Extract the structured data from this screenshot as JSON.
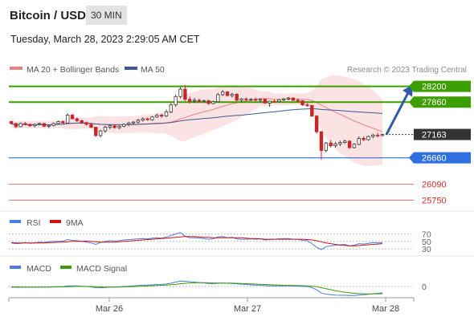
{
  "header": {
    "title": "Bitcoin / USD",
    "interval": "30 MIN",
    "datetime": "Tuesday, March 28, 2023 2:29:05 AM CET"
  },
  "legend": {
    "ma20": "MA 20 + Bollinger Bands",
    "ma50": "MA 50",
    "rsi": "RSI",
    "rsi_ma": "9MA",
    "macd": "MACD",
    "macd_signal": "MACD Signal"
  },
  "watermark": "Research © 2023 Trading Central",
  "colors": {
    "up": "#3a3a3a",
    "down": "#c62828",
    "bollinger": "#f9cccc",
    "ma20": "#f08080",
    "ma50": "#3b5998",
    "resistance": "#3d9e00",
    "support": "#2f6fe0",
    "target": "#e07070",
    "current": "#333333",
    "arrow": "#2e5ca8",
    "rsi": "#4a7de0",
    "rsi_ma": "#d01010",
    "macd": "#4a7de0",
    "macd_signal": "#3d9e00"
  },
  "chart_data": [
    {
      "type": "candlestick",
      "x_labels": [
        "Mar 26",
        "Mar 27",
        "Mar 28"
      ],
      "ylim": [
        25600,
        28400
      ],
      "levels": [
        {
          "name": "resistance-2",
          "value": 28200,
          "label": "28200",
          "kind": "resistance"
        },
        {
          "name": "resistance-1",
          "value": 27860,
          "label": "27860",
          "kind": "resistance"
        },
        {
          "name": "current-price",
          "value": 27163,
          "label": "27163",
          "kind": "current"
        },
        {
          "name": "support-1",
          "value": 26660,
          "label": "26660",
          "kind": "support"
        },
        {
          "name": "target-1",
          "value": 26090,
          "label": "26090",
          "kind": "target"
        },
        {
          "name": "target-2",
          "value": 25750,
          "label": "25750",
          "kind": "target"
        }
      ],
      "candles": [
        [
          27440,
          27460,
          27380,
          27400
        ],
        [
          27400,
          27410,
          27300,
          27330
        ],
        [
          27330,
          27420,
          27320,
          27400
        ],
        [
          27400,
          27430,
          27360,
          27380
        ],
        [
          27380,
          27400,
          27330,
          27350
        ],
        [
          27350,
          27400,
          27320,
          27380
        ],
        [
          27380,
          27420,
          27360,
          27400
        ],
        [
          27400,
          27410,
          27320,
          27340
        ],
        [
          27340,
          27380,
          27300,
          27360
        ],
        [
          27360,
          27420,
          27340,
          27400
        ],
        [
          27400,
          27460,
          27380,
          27440
        ],
        [
          27440,
          27470,
          27390,
          27410
        ],
        [
          27410,
          27620,
          27400,
          27580
        ],
        [
          27580,
          27610,
          27490,
          27500
        ],
        [
          27500,
          27530,
          27430,
          27460
        ],
        [
          27460,
          27480,
          27390,
          27420
        ],
        [
          27420,
          27440,
          27350,
          27380
        ],
        [
          27380,
          27400,
          27300,
          27320
        ],
        [
          27320,
          27330,
          27110,
          27140
        ],
        [
          27140,
          27260,
          27100,
          27240
        ],
        [
          27240,
          27350,
          27200,
          27320
        ],
        [
          27320,
          27380,
          27280,
          27350
        ],
        [
          27350,
          27380,
          27290,
          27310
        ],
        [
          27310,
          27360,
          27280,
          27340
        ],
        [
          27340,
          27400,
          27320,
          27380
        ],
        [
          27380,
          27440,
          27340,
          27410
        ],
        [
          27410,
          27450,
          27380,
          27430
        ],
        [
          27430,
          27500,
          27400,
          27470
        ],
        [
          27470,
          27530,
          27440,
          27500
        ],
        [
          27500,
          27530,
          27460,
          27480
        ],
        [
          27480,
          27560,
          27460,
          27540
        ],
        [
          27540,
          27610,
          27520,
          27580
        ],
        [
          27580,
          27610,
          27520,
          27560
        ],
        [
          27560,
          27700,
          27540,
          27650
        ],
        [
          27650,
          27840,
          27620,
          27800
        ],
        [
          27800,
          28020,
          27760,
          27980
        ],
        [
          27980,
          28180,
          27940,
          28140
        ],
        [
          28140,
          28230,
          27880,
          27920
        ],
        [
          27920,
          27980,
          27830,
          27880
        ],
        [
          27880,
          27950,
          27840,
          27900
        ],
        [
          27900,
          27930,
          27850,
          27870
        ],
        [
          27870,
          27920,
          27840,
          27890
        ],
        [
          27890,
          27910,
          27800,
          27830
        ],
        [
          27830,
          27890,
          27810,
          27870
        ],
        [
          27870,
          28060,
          27850,
          28020
        ],
        [
          28020,
          28120,
          27990,
          28080
        ],
        [
          28080,
          28100,
          27980,
          28000
        ],
        [
          28000,
          28060,
          27960,
          28030
        ],
        [
          28030,
          28050,
          27880,
          27900
        ],
        [
          27900,
          27950,
          27850,
          27930
        ],
        [
          27930,
          27960,
          27880,
          27910
        ],
        [
          27910,
          27950,
          27880,
          27920
        ],
        [
          27920,
          27960,
          27880,
          27900
        ],
        [
          27900,
          27940,
          27860,
          27920
        ],
        [
          27920,
          27940,
          27820,
          27840
        ],
        [
          27840,
          27890,
          27760,
          27880
        ],
        [
          27880,
          27910,
          27850,
          27870
        ],
        [
          27870,
          27930,
          27850,
          27910
        ],
        [
          27910,
          27950,
          27880,
          27930
        ],
        [
          27930,
          27970,
          27900,
          27950
        ],
        [
          27950,
          27960,
          27880,
          27900
        ],
        [
          27900,
          27940,
          27860,
          27890
        ],
        [
          27890,
          27900,
          27780,
          27800
        ],
        [
          27800,
          27840,
          27760,
          27790
        ],
        [
          27790,
          27800,
          27540,
          27560
        ],
        [
          27560,
          27580,
          27180,
          27220
        ],
        [
          27220,
          27240,
          26620,
          26820
        ],
        [
          26820,
          27000,
          26780,
          26980
        ],
        [
          26980,
          27040,
          26880,
          26920
        ],
        [
          26920,
          27000,
          26880,
          26960
        ],
        [
          26960,
          27030,
          26910,
          26990
        ],
        [
          26990,
          27050,
          26960,
          27020
        ],
        [
          27020,
          27040,
          26850,
          26880
        ],
        [
          26880,
          26980,
          26860,
          26950
        ],
        [
          26950,
          27120,
          26930,
          27080
        ],
        [
          27080,
          27120,
          27020,
          27050
        ],
        [
          27050,
          27140,
          27030,
          27120
        ],
        [
          27120,
          27180,
          27080,
          27150
        ],
        [
          27150,
          27200,
          27100,
          27140
        ],
        [
          27140,
          27180,
          27120,
          27163
        ]
      ]
    },
    {
      "type": "line",
      "name": "RSI",
      "reference_levels": [
        70,
        50,
        30
      ],
      "reference_labels": [
        "70",
        "50",
        "30"
      ],
      "ylim": [
        15,
        80
      ],
      "series": [
        {
          "name": "RSI",
          "values": [
            46,
            44,
            45,
            47,
            45,
            46,
            48,
            47,
            49,
            50,
            50,
            51,
            55,
            53,
            52,
            50,
            48,
            46,
            42,
            47,
            50,
            52,
            51,
            52,
            54,
            55,
            56,
            57,
            58,
            57,
            59,
            60,
            59,
            62,
            66,
            70,
            74,
            64,
            60,
            60,
            59,
            58,
            56,
            57,
            62,
            63,
            60,
            61,
            57,
            56,
            56,
            57,
            56,
            57,
            54,
            55,
            56,
            57,
            58,
            58,
            56,
            56,
            53,
            52,
            44,
            34,
            28,
            36,
            38,
            40,
            41,
            42,
            38,
            40,
            44,
            43,
            45,
            47,
            46,
            47
          ]
        },
        {
          "name": "9MA",
          "values": [
            47,
            46,
            46,
            46,
            46,
            46,
            46,
            46,
            47,
            47,
            48,
            48,
            49,
            50,
            50,
            50,
            51,
            50,
            49,
            48,
            48,
            48,
            48,
            49,
            50,
            51,
            52,
            53,
            54,
            55,
            56,
            57,
            58,
            59,
            60,
            61,
            62,
            63,
            63,
            63,
            62,
            61,
            61,
            60,
            60,
            60,
            60,
            60,
            60,
            60,
            59,
            58,
            58,
            57,
            56,
            56,
            56,
            56,
            56,
            56,
            56,
            56,
            56,
            55,
            54,
            52,
            49,
            46,
            44,
            42,
            40,
            39,
            38,
            38,
            39,
            40,
            41,
            42,
            43,
            44
          ]
        }
      ]
    },
    {
      "type": "line",
      "name": "MACD",
      "reference_levels": [
        0
      ],
      "reference_labels": [
        "0"
      ],
      "ylim": [
        -220,
        220
      ],
      "series": [
        {
          "name": "MACD",
          "values": [
            -10,
            -15,
            -14,
            -12,
            -14,
            -13,
            -10,
            -12,
            -10,
            -6,
            -4,
            -2,
            10,
            12,
            10,
            6,
            0,
            -8,
            -22,
            -24,
            -18,
            -12,
            -10,
            -6,
            0,
            6,
            12,
            18,
            24,
            26,
            30,
            36,
            38,
            44,
            60,
            80,
            100,
            96,
            88,
            80,
            72,
            64,
            56,
            52,
            58,
            62,
            58,
            56,
            48,
            42,
            36,
            30,
            26,
            22,
            16,
            12,
            10,
            10,
            10,
            10,
            8,
            6,
            2,
            -2,
            -20,
            -60,
            -120,
            -140,
            -150,
            -158,
            -160,
            -160,
            -164,
            -164,
            -156,
            -150,
            -142,
            -132,
            -124,
            -116
          ]
        },
        {
          "name": "MACD Signal",
          "values": [
            -6,
            -8,
            -9,
            -10,
            -10,
            -10,
            -10,
            -10,
            -10,
            -9,
            -8,
            -7,
            -4,
            -1,
            1,
            2,
            2,
            0,
            -4,
            -8,
            -10,
            -10,
            -10,
            -10,
            -8,
            -5,
            -2,
            2,
            6,
            10,
            14,
            18,
            22,
            26,
            32,
            40,
            50,
            58,
            64,
            68,
            70,
            70,
            68,
            65,
            64,
            63,
            62,
            61,
            58,
            55,
            52,
            48,
            44,
            40,
            36,
            32,
            28,
            25,
            22,
            20,
            18,
            16,
            14,
            11,
            6,
            -4,
            -22,
            -40,
            -58,
            -76,
            -92,
            -104,
            -114,
            -124,
            -130,
            -134,
            -136,
            -136,
            -134,
            -130
          ]
        }
      ]
    }
  ]
}
